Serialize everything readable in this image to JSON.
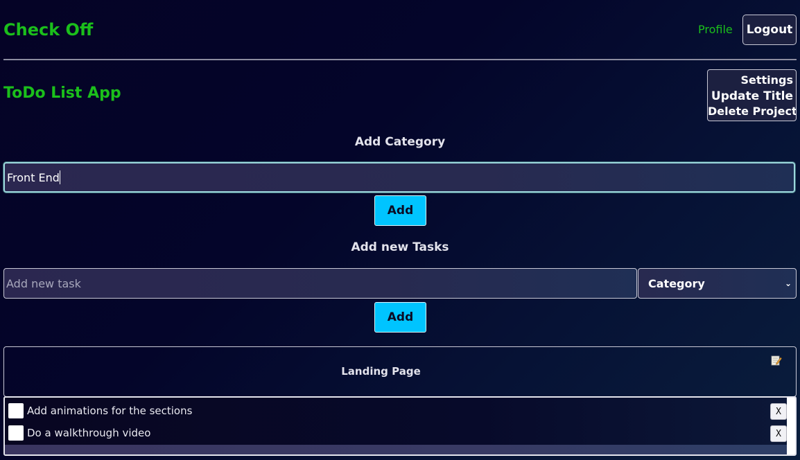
{
  "header": {
    "brand": "Check Off",
    "profile_label": "Profile",
    "logout_label": "Logout"
  },
  "project": {
    "title": "ToDo List App",
    "settings": {
      "settings_label": "Settings",
      "update_title_label": "Update Title",
      "delete_project_label": "Delete Project"
    }
  },
  "add_category": {
    "heading": "Add Category",
    "input_value": "Front End",
    "add_label": "Add"
  },
  "add_task": {
    "heading": "Add new Tasks",
    "placeholder": "Add new task",
    "category_select": "Category",
    "add_label": "Add"
  },
  "categories": [
    {
      "name": "Landing Page",
      "edit_icon": "memo-icon",
      "tasks": [
        {
          "text": "Add animations for the sections",
          "delete_label": "X"
        },
        {
          "text": "Do a walkthrough video",
          "delete_label": "X"
        }
      ]
    }
  ],
  "colors": {
    "brand_green": "#1bbf1b",
    "accent_button": "#00c4ff",
    "background": "#050326"
  }
}
